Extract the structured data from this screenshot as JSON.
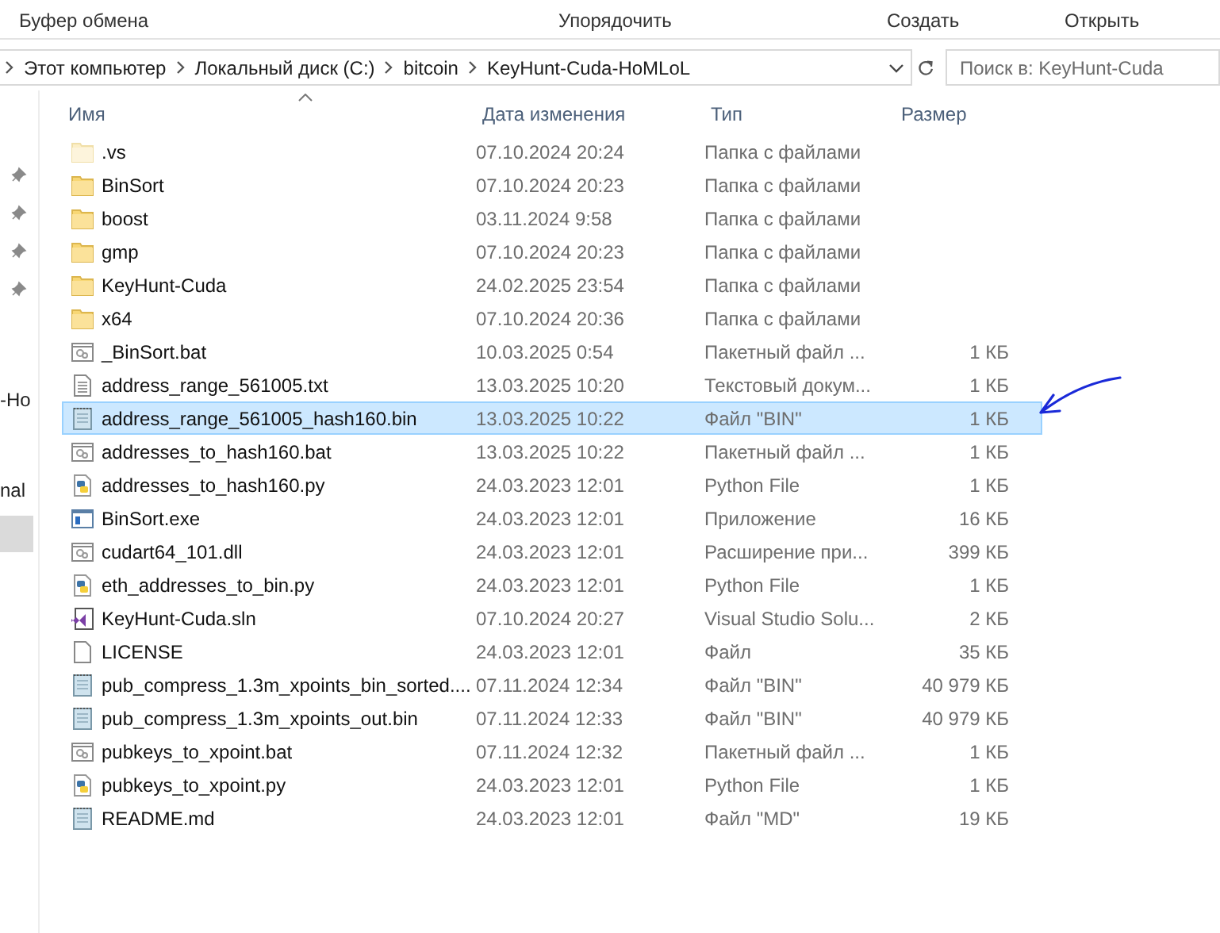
{
  "ribbon": {
    "groups": [
      "Буфер обмена",
      "Упорядочить",
      "Создать",
      "Открыть"
    ]
  },
  "address_bar": {
    "crumbs": [
      "Этот компьютер",
      "Локальный диск (C:)",
      "bitcoin",
      "KeyHunt-Cuda-HoMLoL"
    ]
  },
  "search": {
    "placeholder": "Поиск в: KeyHunt-Cuda"
  },
  "nav_pane": {
    "items": [
      {
        "kind": "pin"
      },
      {
        "kind": "pin"
      },
      {
        "kind": "pin"
      },
      {
        "kind": "pin"
      },
      {
        "kind": "text",
        "label": "-Ho"
      },
      {
        "kind": "text",
        "label": "nal"
      },
      {
        "kind": "selected"
      }
    ]
  },
  "table": {
    "columns": [
      "Имя",
      "Дата изменения",
      "Тип",
      "Размер"
    ],
    "rows": [
      {
        "kind": "folder",
        "hidden": true,
        "name": ".vs",
        "date": "07.10.2024 20:24",
        "type": "Папка с файлами",
        "size": "",
        "selected": false
      },
      {
        "kind": "folder",
        "hidden": false,
        "name": "BinSort",
        "date": "07.10.2024 20:23",
        "type": "Папка с файлами",
        "size": "",
        "selected": false
      },
      {
        "kind": "folder",
        "hidden": false,
        "name": "boost",
        "date": "03.11.2024 9:58",
        "type": "Папка с файлами",
        "size": "",
        "selected": false
      },
      {
        "kind": "folder",
        "hidden": false,
        "name": "gmp",
        "date": "07.10.2024 20:23",
        "type": "Папка с файлами",
        "size": "",
        "selected": false
      },
      {
        "kind": "folder",
        "hidden": false,
        "name": "KeyHunt-Cuda",
        "date": "24.02.2025 23:54",
        "type": "Папка с файлами",
        "size": "",
        "selected": false
      },
      {
        "kind": "folder",
        "hidden": false,
        "name": "x64",
        "date": "07.10.2024 20:36",
        "type": "Папка с файлами",
        "size": "",
        "selected": false
      },
      {
        "kind": "bat",
        "name": "_BinSort.bat",
        "date": "10.03.2025 0:54",
        "type": "Пакетный файл ...",
        "size": "1 КБ",
        "selected": false
      },
      {
        "kind": "txt",
        "name": "address_range_561005.txt",
        "date": "13.03.2025 10:20",
        "type": "Текстовый докум...",
        "size": "1 КБ",
        "selected": false
      },
      {
        "kind": "bin",
        "name": "address_range_561005_hash160.bin",
        "date": "13.03.2025 10:22",
        "type": "Файл \"BIN\"",
        "size": "1 КБ",
        "selected": true
      },
      {
        "kind": "bat",
        "name": "addresses_to_hash160.bat",
        "date": "13.03.2025 10:22",
        "type": "Пакетный файл ...",
        "size": "1 КБ",
        "selected": false
      },
      {
        "kind": "py",
        "name": "addresses_to_hash160.py",
        "date": "24.03.2023 12:01",
        "type": "Python File",
        "size": "1 КБ",
        "selected": false
      },
      {
        "kind": "exe",
        "name": "BinSort.exe",
        "date": "24.03.2023 12:01",
        "type": "Приложение",
        "size": "16 КБ",
        "selected": false
      },
      {
        "kind": "dll",
        "name": "cudart64_101.dll",
        "date": "24.03.2023 12:01",
        "type": "Расширение при...",
        "size": "399 КБ",
        "selected": false
      },
      {
        "kind": "py",
        "name": "eth_addresses_to_bin.py",
        "date": "24.03.2023 12:01",
        "type": "Python File",
        "size": "1 КБ",
        "selected": false
      },
      {
        "kind": "sln",
        "name": "KeyHunt-Cuda.sln",
        "date": "07.10.2024 20:27",
        "type": "Visual Studio Solu...",
        "size": "2 КБ",
        "selected": false
      },
      {
        "kind": "file",
        "name": "LICENSE",
        "date": "24.03.2023 12:01",
        "type": "Файл",
        "size": "35 КБ",
        "selected": false
      },
      {
        "kind": "bin",
        "name": "pub_compress_1.3m_xpoints_bin_sorted....",
        "date": "07.11.2024 12:34",
        "type": "Файл \"BIN\"",
        "size": "40 979 КБ",
        "selected": false
      },
      {
        "kind": "bin",
        "name": "pub_compress_1.3m_xpoints_out.bin",
        "date": "07.11.2024 12:33",
        "type": "Файл \"BIN\"",
        "size": "40 979 КБ",
        "selected": false
      },
      {
        "kind": "bat",
        "name": "pubkeys_to_xpoint.bat",
        "date": "07.11.2024 12:32",
        "type": "Пакетный файл ...",
        "size": "1 КБ",
        "selected": false
      },
      {
        "kind": "py",
        "name": "pubkeys_to_xpoint.py",
        "date": "24.03.2023 12:01",
        "type": "Python File",
        "size": "1 КБ",
        "selected": false
      },
      {
        "kind": "bin",
        "name": "README.md",
        "date": "24.03.2023 12:01",
        "type": "Файл \"MD\"",
        "size": "19 КБ",
        "selected": false
      }
    ]
  }
}
